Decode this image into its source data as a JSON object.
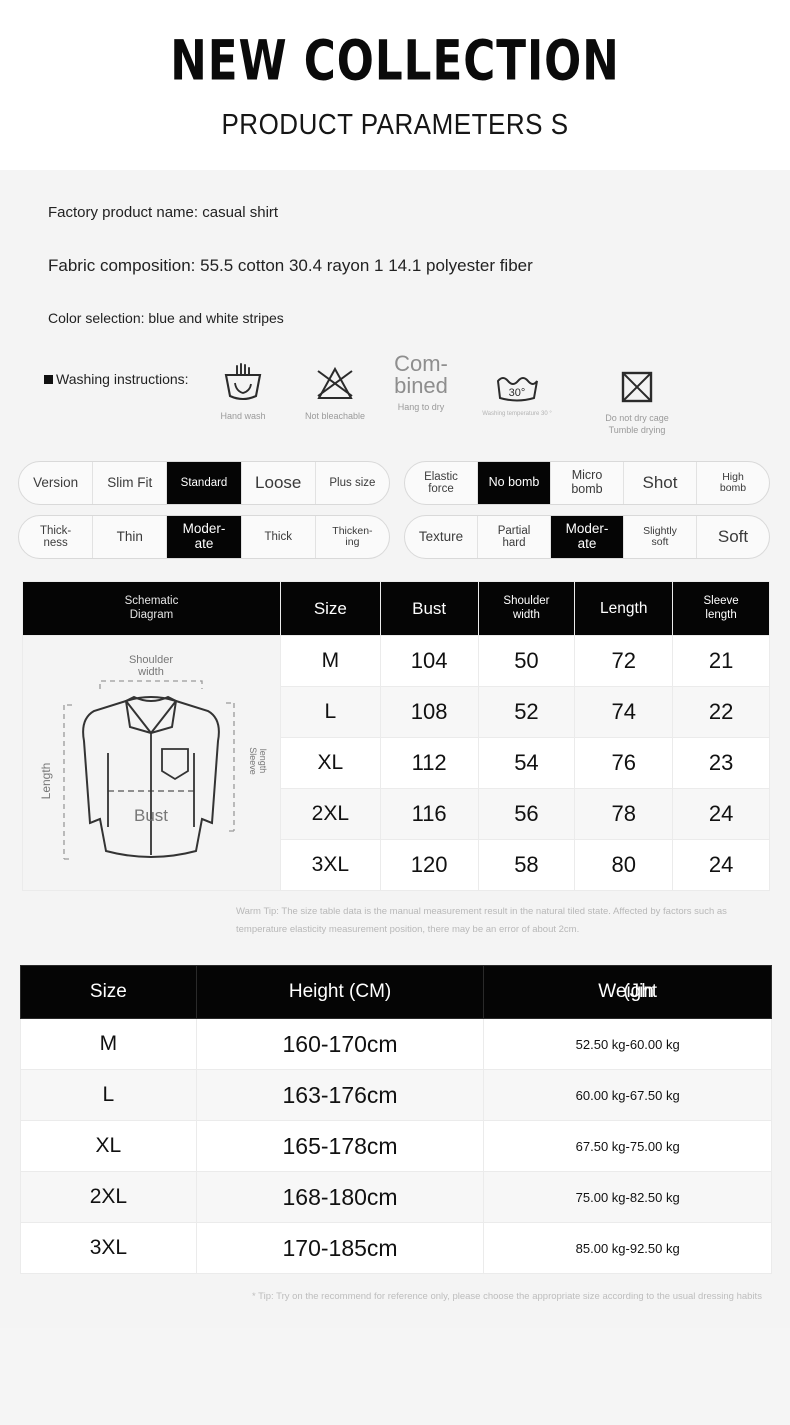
{
  "header": {
    "title": "NEW COLLECTION",
    "subtitle": "PRODUCT PARAMETERS S"
  },
  "specs": {
    "product_name": "Factory product name: casual shirt",
    "fabric": "Fabric composition: 55.5 cotton 30.4 rayon 1 14.1 polyester fiber",
    "color": "Color selection: blue and white stripes"
  },
  "washing": {
    "label": "Washing instructions:",
    "items": [
      {
        "icon": "hand-wash-icon",
        "caption": "Hand wash"
      },
      {
        "icon": "no-bleach-icon",
        "caption": "Not bleachable"
      },
      {
        "icon": "hang-to-dry-text",
        "text_line1": "Com-",
        "text_line2": "bined",
        "caption": "Hang to dry"
      },
      {
        "icon": "wash-30-degrees-icon",
        "temp": "30°",
        "caption": "Washing temperature 30 °"
      },
      {
        "icon": "do-not-tumble-dry-icon",
        "caption_line1": "Do not dry cage",
        "caption_line2": "Tumble drying"
      }
    ]
  },
  "options": [
    {
      "name": "version",
      "head": "Version",
      "cells": [
        {
          "label": "Slim Fit",
          "selected": false,
          "size": "fs13"
        },
        {
          "label": "Standard",
          "selected": true,
          "size": "fs11"
        },
        {
          "label": "Loose",
          "selected": false,
          "size": "fs17"
        },
        {
          "label": "Plus size",
          "selected": false,
          "size": "fs11"
        }
      ]
    },
    {
      "name": "elastic-force",
      "head": "Elastic force",
      "head_line1": "Elastic",
      "head_line2": "force",
      "cells": [
        {
          "label": "No bomb",
          "selected": true,
          "size": "fs12"
        },
        {
          "label": "Micro bomb",
          "line1": "Micro",
          "line2": "bomb",
          "selected": false,
          "size": "fs12"
        },
        {
          "label": "Shot",
          "selected": false,
          "size": "fs17"
        },
        {
          "label": "High bomb",
          "line1": "High",
          "line2": "bomb",
          "selected": false,
          "size": "fs10"
        }
      ]
    },
    {
      "name": "thickness",
      "head": "Thickness",
      "head_line1": "Thick-",
      "head_line2": "ness",
      "cells": [
        {
          "label": "Thin",
          "selected": false,
          "size": "fs13"
        },
        {
          "label": "Moderate",
          "line1": "Moder-",
          "line2": "ate",
          "selected": true,
          "size": "fs13"
        },
        {
          "label": "Thick",
          "selected": false,
          "size": "fs11"
        },
        {
          "label": "Thickening",
          "line1": "Thicken-",
          "line2": "ing",
          "selected": false,
          "size": "fs10"
        }
      ]
    },
    {
      "name": "texture",
      "head": "Texture",
      "cells": [
        {
          "label": "Partial hard",
          "line1": "Partial",
          "line2": "hard",
          "selected": false,
          "size": "fs11"
        },
        {
          "label": "Moderate",
          "line1": "Moder-",
          "line2": "ate",
          "selected": true,
          "size": "fs13"
        },
        {
          "label": "Slightly soft",
          "line1": "Slightly",
          "line2": "soft",
          "selected": false,
          "size": "fs10"
        },
        {
          "label": "Soft",
          "selected": false,
          "size": "fs17"
        }
      ]
    }
  ],
  "size_table": {
    "headers": {
      "diagram_line1": "Schematic",
      "diagram_line2": "Diagram",
      "size": "Size",
      "bust": "Bust",
      "shoulder_line1": "Shoulder",
      "shoulder_line2": "width",
      "length": "Length",
      "sleeve_line1": "Sleeve",
      "sleeve_line2": "length"
    },
    "diagram_labels": {
      "shoulder_line1": "Shoulder",
      "shoulder_line2": "width",
      "length": "Length",
      "sleeve_line1": "Sleeve",
      "sleeve_line2": "length",
      "bust": "Bust"
    },
    "rows": [
      {
        "size": "M",
        "bust": "104",
        "shoulder": "50",
        "length": "72",
        "sleeve": "21"
      },
      {
        "size": "L",
        "bust": "108",
        "shoulder": "52",
        "length": "74",
        "sleeve": "22"
      },
      {
        "size": "XL",
        "bust": "112",
        "shoulder": "54",
        "length": "76",
        "sleeve": "23"
      },
      {
        "size": "2XL",
        "bust": "116",
        "shoulder": "56",
        "length": "78",
        "sleeve": "24"
      },
      {
        "size": "3XL",
        "bust": "120",
        "shoulder": "58",
        "length": "80",
        "sleeve": "24"
      }
    ],
    "warm_tip": "Warm Tip: The size table data is the manual measurement result in the natural tiled state. Affected by factors such as temperature elasticity measurement position, there may be an error of about 2cm."
  },
  "fit_table": {
    "headers": {
      "size": "Size",
      "height": "Height (CM)",
      "weight": "Weight",
      "weight_overlap": "(Jin"
    },
    "rows": [
      {
        "size": "M",
        "height": "160-170cm",
        "weight": "52.50 kg-60.00 kg"
      },
      {
        "size": "L",
        "height": "163-176cm",
        "weight": "60.00 kg-67.50 kg"
      },
      {
        "size": "XL",
        "height": "165-178cm",
        "weight": "67.50 kg-75.00 kg"
      },
      {
        "size": "2XL",
        "height": "168-180cm",
        "weight": "75.00 kg-82.50 kg"
      },
      {
        "size": "3XL",
        "height": "170-185cm",
        "weight": "85.00 kg-92.50 kg"
      }
    ],
    "foot_tip": "* Tip: Try on the recommend for reference only, please choose the appropriate size according to the usual dressing habits"
  },
  "colors": {
    "selected_bg": "#050505",
    "page_bg": "#f4f4f4",
    "header_bg": "#ffffff",
    "muted_text": "#b8b8b8"
  }
}
